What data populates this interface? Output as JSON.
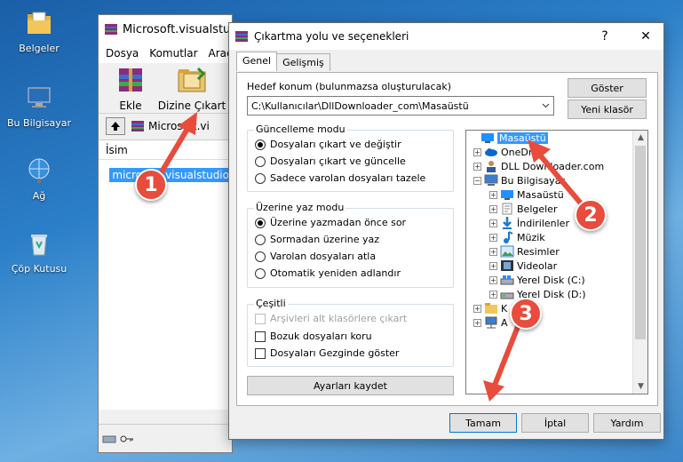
{
  "desktop": {
    "icons": [
      {
        "label": "Belgeler",
        "icon": "folder-documents-icon"
      },
      {
        "label": "Bu Bilgisayar",
        "icon": "computer-icon"
      },
      {
        "label": "Ağ",
        "icon": "network-icon"
      },
      {
        "label": "Çöp Kutusu",
        "icon": "recycle-bin-icon"
      }
    ]
  },
  "winrar": {
    "title": "Microsoft.visualstudio",
    "menu": [
      "Dosya",
      "Komutlar",
      "Araçla"
    ],
    "toolbar": {
      "add_label": "Ekle",
      "extract_label": "Dizine Çıkart"
    },
    "address": "Microsoft.vi",
    "list_header": "İsim",
    "selected_file": "microsoft.visualstudio"
  },
  "dialog": {
    "title": "Çıkartma yolu ve seçenekleri",
    "help_glyph": "?",
    "close_glyph": "✕",
    "tabs": [
      "Genel",
      "Gelişmiş"
    ],
    "dest_label": "Hedef konum (bulunmazsa oluşturulacak)",
    "dest_value": "C:\\Kullanıcılar\\DllDownloader_com\\Masaüstü",
    "show_button": "Göster",
    "new_folder_button": "Yeni klasör",
    "update_group": {
      "title": "Güncelleme modu",
      "options": [
        "Dosyaları çıkart ve değiştir",
        "Dosyaları çıkart ve güncelle",
        "Sadece varolan dosyaları tazele"
      ],
      "selected": 0
    },
    "overwrite_group": {
      "title": "Üzerine yaz modu",
      "options": [
        "Üzerine yazmadan önce sor",
        "Sormadan üzerine yaz",
        "Varolan dosyaları atla",
        "Otomatik yeniden adlandır"
      ],
      "selected": 0
    },
    "misc_group": {
      "title": "Çeşitli",
      "options": [
        "Arşivleri alt klasörlere çıkart",
        "Bozuk dosyaları koru",
        "Dosyaları Gezginde göster"
      ]
    },
    "save_settings_button": "Ayarları kaydet",
    "tree": [
      {
        "label": "Masaüstü",
        "level": 0,
        "selected": true,
        "exp": ""
      },
      {
        "label": "OneDr",
        "level": 1,
        "exp": "+"
      },
      {
        "label": "DLL Downloader.com",
        "level": 1,
        "exp": "+"
      },
      {
        "label": "Bu Bilgisayar",
        "level": 1,
        "exp": "−"
      },
      {
        "label": "Masaüstü",
        "level": 2,
        "exp": "+"
      },
      {
        "label": "Belgeler",
        "level": 2,
        "exp": "+"
      },
      {
        "label": "İndirilenler",
        "level": 2,
        "exp": "+"
      },
      {
        "label": "Müzik",
        "level": 2,
        "exp": "+"
      },
      {
        "label": "Resimler",
        "level": 2,
        "exp": "+"
      },
      {
        "label": "Videolar",
        "level": 2,
        "exp": "+"
      },
      {
        "label": "Yerel Disk (C:)",
        "level": 2,
        "exp": "+"
      },
      {
        "label": "Yerel Disk (D:)",
        "level": 2,
        "exp": "+"
      },
      {
        "label": "K",
        "level": 1,
        "exp": "+"
      },
      {
        "label": "A",
        "level": 1,
        "exp": "+"
      }
    ],
    "ok_button": "Tamam",
    "cancel_button": "İptal",
    "help_button": "Yardım"
  },
  "annotations": [
    "1",
    "2",
    "3"
  ],
  "colors": {
    "arrow_red": "#e74c3c",
    "selection_blue": "#3399ff"
  }
}
